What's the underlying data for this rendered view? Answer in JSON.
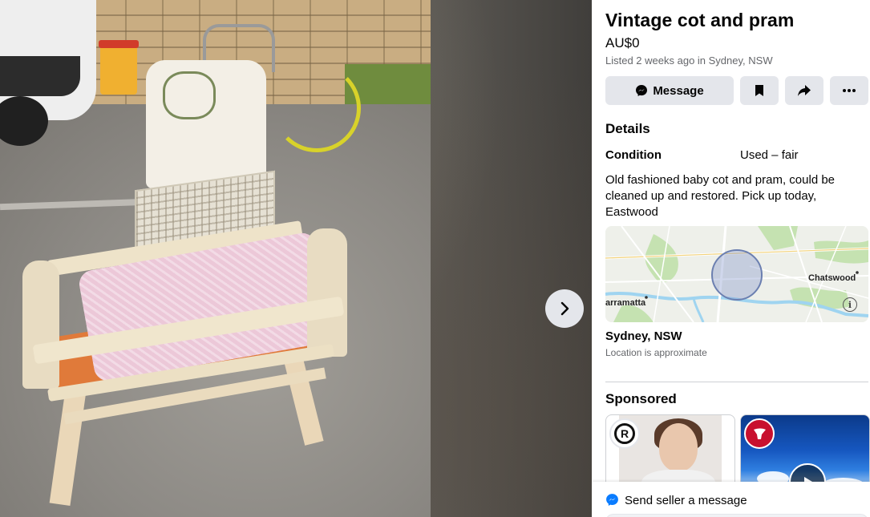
{
  "listing": {
    "title": "Vintage cot and pram",
    "price": "AU$0",
    "listed": "Listed 2 weeks ago in Sydney, NSW"
  },
  "actions": {
    "message_label": "Message",
    "save_icon": "bookmark-icon",
    "share_icon": "share-icon",
    "more_icon": "more-icon"
  },
  "details": {
    "heading": "Details",
    "condition_label": "Condition",
    "condition_value": "Used – fair",
    "description": "Old fashioned baby cot and pram, could be cleaned up and restored. Pick up today, Eastwood"
  },
  "map": {
    "label_left": "arramatta",
    "label_right": "Chatswood",
    "info_glyph": "i"
  },
  "location": {
    "title": "Sydney, NSW",
    "note": "Location is approximate"
  },
  "sponsored": {
    "heading": "Sponsored"
  },
  "send": {
    "label": "Send seller a message"
  },
  "colors": {
    "button_bg": "#e4e6eb",
    "text_primary": "#050505",
    "text_secondary": "#65676b",
    "messenger_blue": "#0a7cff",
    "divider": "#ced0d4"
  }
}
